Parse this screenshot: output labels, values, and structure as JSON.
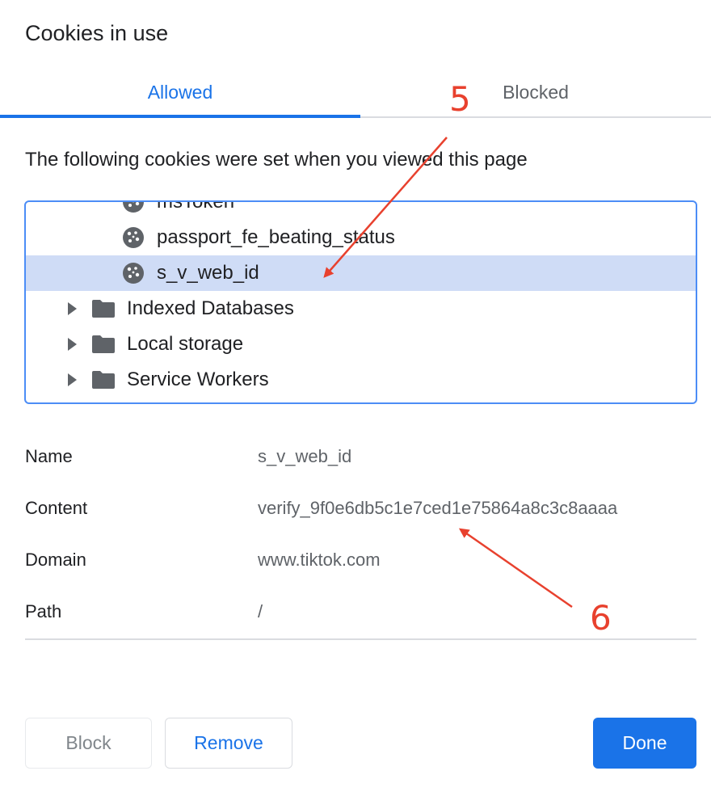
{
  "dialog": {
    "title": "Cookies in use"
  },
  "tabs": [
    {
      "label": "Allowed",
      "active": true
    },
    {
      "label": "Blocked",
      "active": false
    }
  ],
  "description": "The following cookies were set when you viewed this page",
  "tree": {
    "rows": [
      {
        "label": "msToken",
        "type": "cookie",
        "selected": false
      },
      {
        "label": "passport_fe_beating_status",
        "type": "cookie",
        "selected": false
      },
      {
        "label": "s_v_web_id",
        "type": "cookie",
        "selected": true
      },
      {
        "label": "Indexed Databases",
        "type": "folder",
        "selected": false
      },
      {
        "label": "Local storage",
        "type": "folder",
        "selected": false
      },
      {
        "label": "Service Workers",
        "type": "folder",
        "selected": false
      }
    ]
  },
  "details": {
    "name": {
      "label": "Name",
      "value": "s_v_web_id"
    },
    "content": {
      "label": "Content",
      "value": "verify_9f0e6db5c1e7ced1e75864a8c3c8aaaa"
    },
    "domain": {
      "label": "Domain",
      "value": "www.tiktok.com"
    },
    "path": {
      "label": "Path",
      "value": "/"
    }
  },
  "buttons": {
    "block": "Block",
    "remove": "Remove",
    "done": "Done"
  },
  "annotations": {
    "arrow5": "5",
    "arrow6": "6",
    "color": "#e8412e"
  },
  "colors": {
    "accent": "#1a73e8",
    "selected_row": "#cfdcf6"
  }
}
